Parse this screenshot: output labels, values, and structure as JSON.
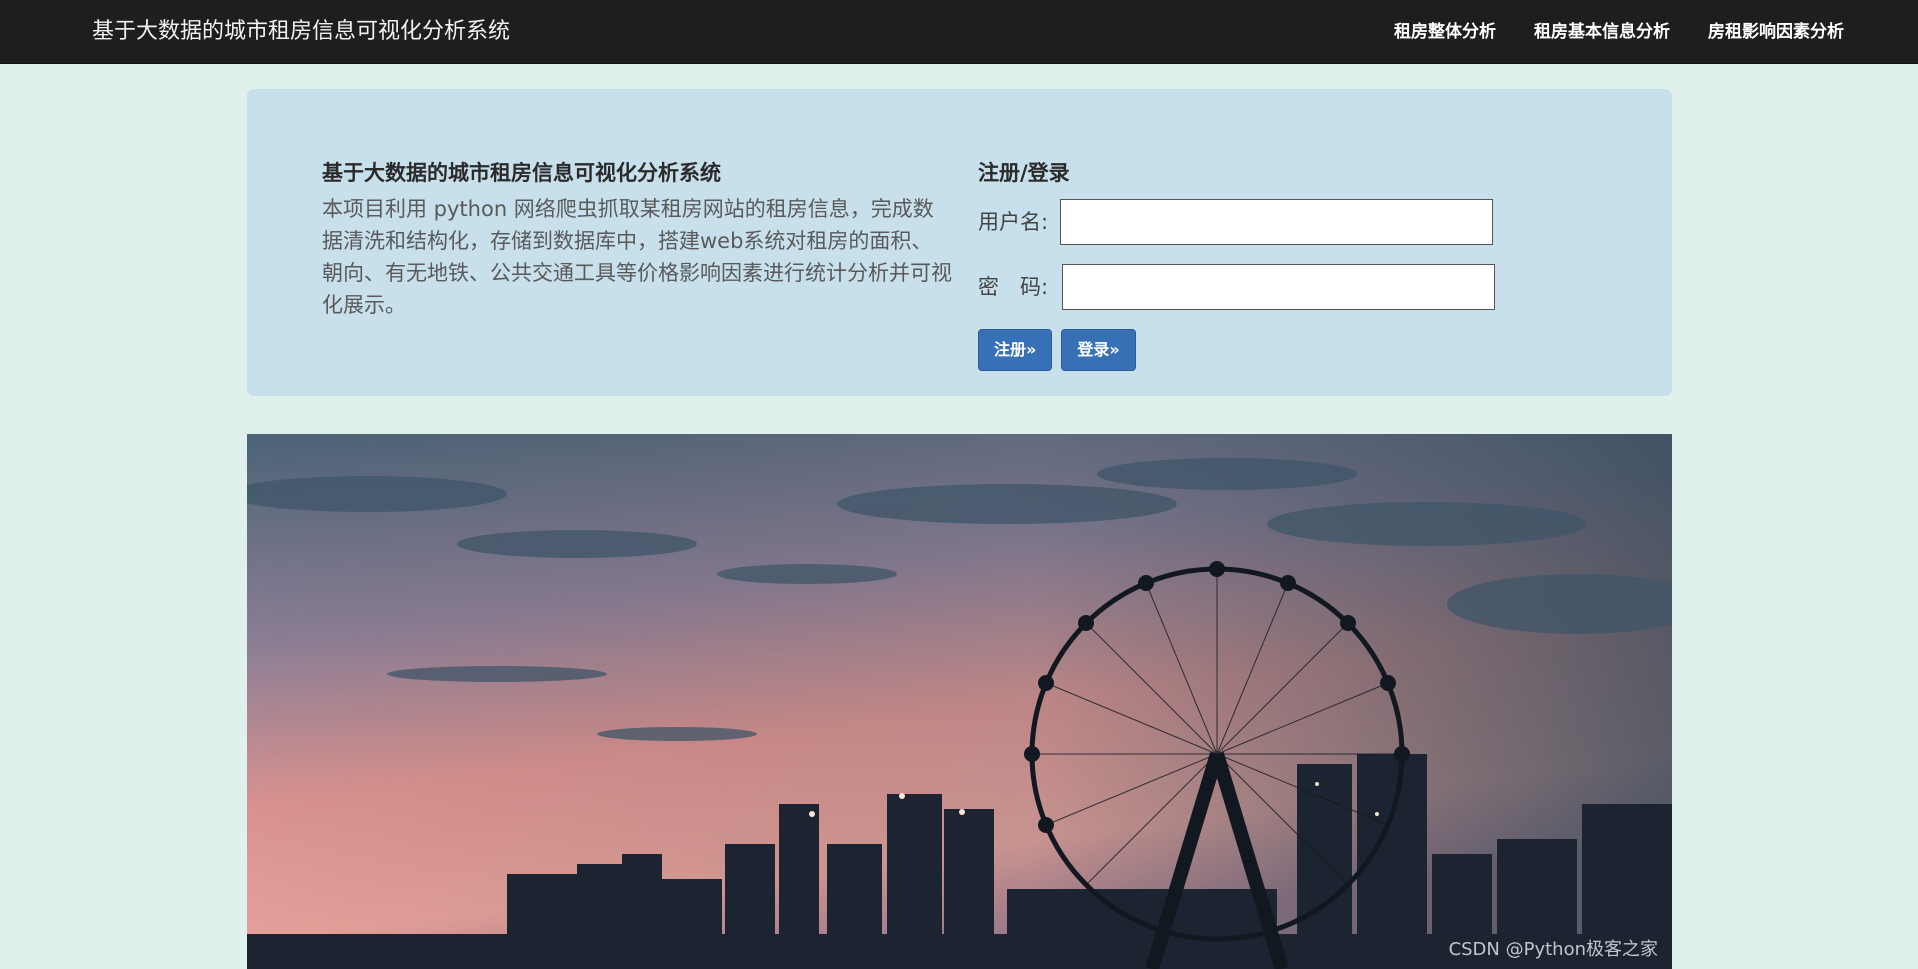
{
  "navbar": {
    "brand": "基于大数据的城市租房信息可视化分析系统",
    "links": [
      "租房整体分析",
      "租房基本信息分析",
      "房租影响因素分析"
    ]
  },
  "intro": {
    "title": "基于大数据的城市租房信息可视化分析系统",
    "text": "本项目利用 python 网络爬虫抓取某租房网站的租房信息，完成数据清洗和结构化，存储到数据库中，搭建web系统对租房的面积、朝向、有无地铁、公共交通工具等价格影响因素进行统计分析并可视化展示。"
  },
  "login": {
    "title": "注册/登录",
    "username_label": "用户名:",
    "username_value": "",
    "password_label": "密　码:",
    "password_value": "",
    "register_label": "注册»",
    "login_label": "登录»"
  },
  "watermark": "CSDN @Python极客之家",
  "colors": {
    "navbar": "#1e1e1e",
    "page_bg": "#e0f0ec",
    "panel_bg": "#c8dfec",
    "button": "#3770b5"
  }
}
